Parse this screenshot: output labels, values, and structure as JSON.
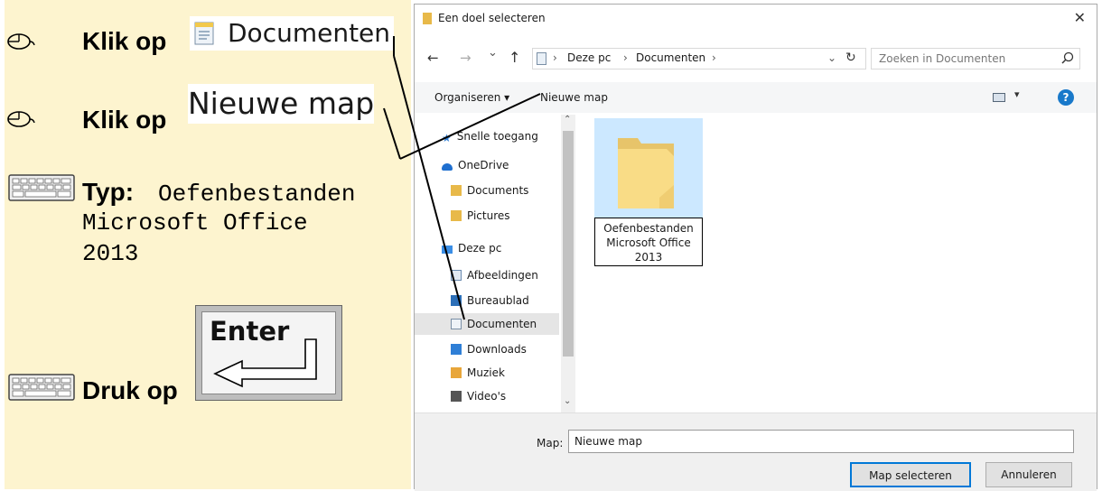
{
  "instructions": [
    {
      "icon": "mouse-icon",
      "prefix": "Klik op",
      "target": "Documenten"
    },
    {
      "icon": "mouse-icon",
      "prefix": "Klik op",
      "target": "Nieuwe map"
    },
    {
      "icon": "keyboard-icon",
      "prefix": "Typ:",
      "text_lines": [
        "Oefenbestanden",
        "Microsoft Office",
        "2013"
      ]
    },
    {
      "icon": "keyboard-icon",
      "prefix": "Druk op",
      "key": "Enter"
    }
  ],
  "dialog": {
    "title": "Een doel selecteren",
    "close_glyph": "✕",
    "nav_arrows": {
      "back": "←",
      "forward": "→",
      "recent": "⌄",
      "up": "↑"
    },
    "breadcrumb": [
      "Deze pc",
      "Documenten"
    ],
    "breadcrumb_sep": "›",
    "refresh_glyph": "↻",
    "search_placeholder": "Zoeken in Documenten",
    "toolbar": {
      "organize": "Organiseren ▾",
      "new_folder": "Nieuwe map",
      "help": "?"
    },
    "nav_items": [
      {
        "label": "Snelle toegang",
        "icon": "star-icon"
      },
      {
        "label": "OneDrive",
        "icon": "cloud-icon"
      },
      {
        "label": "Documents",
        "icon": "folder-icon"
      },
      {
        "label": "Pictures",
        "icon": "folder-icon"
      },
      {
        "label": "Deze pc",
        "icon": "computer-icon"
      },
      {
        "label": "Afbeeldingen",
        "icon": "pictures-icon"
      },
      {
        "label": "Bureaublad",
        "icon": "desktop-icon"
      },
      {
        "label": "Documenten",
        "icon": "documents-icon"
      },
      {
        "label": "Downloads",
        "icon": "downloads-icon"
      },
      {
        "label": "Muziek",
        "icon": "music-icon"
      },
      {
        "label": "Video's",
        "icon": "video-icon"
      }
    ],
    "new_folder_name_lines": [
      "Oefenbestanden",
      "Microsoft Office",
      "2013"
    ],
    "footer": {
      "map_label": "Map:",
      "map_value": "Nieuwe map",
      "select_button": "Map selecteren",
      "cancel_button": "Annuleren"
    }
  },
  "colors": {
    "panel_bg": "#fdf4cf",
    "selected_bg": "#cce8ff",
    "accent": "#0078d7",
    "folder": "#f7d674"
  }
}
